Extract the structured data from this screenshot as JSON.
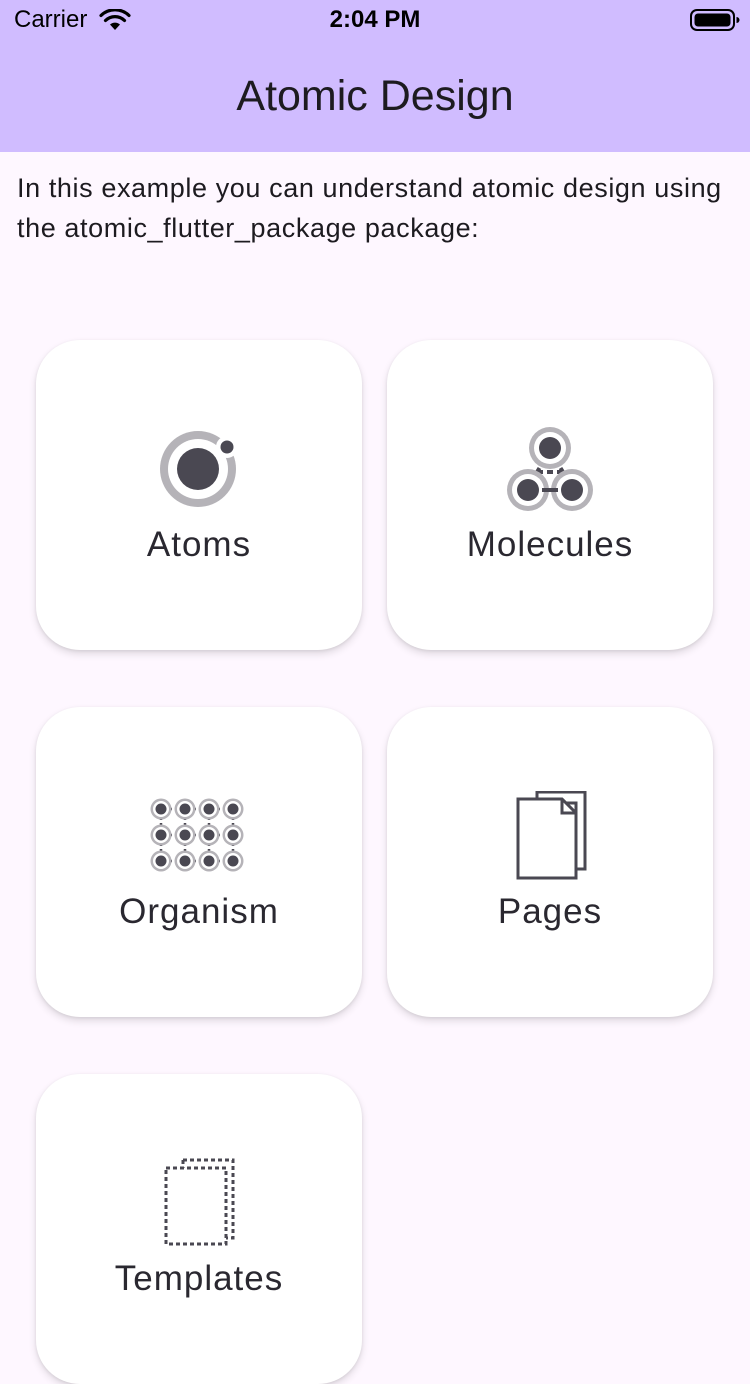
{
  "status_bar": {
    "carrier": "Carrier",
    "time": "2:04 PM",
    "wifi_icon": "wifi-icon",
    "battery_icon": "battery-icon"
  },
  "app_bar": {
    "title": "Atomic Design"
  },
  "intro_text": "In this example you can understand atomic design using the atomic_flutter_package package:",
  "cards": [
    {
      "label": "Atoms",
      "icon": "atom-icon"
    },
    {
      "label": "Molecules",
      "icon": "molecule-icon"
    },
    {
      "label": "Organism",
      "icon": "organism-icon"
    },
    {
      "label": "Pages",
      "icon": "pages-icon"
    },
    {
      "label": "Templates",
      "icon": "templates-icon"
    }
  ],
  "colors": {
    "app_bar": "#d0bcff",
    "background": "#fef7ff",
    "card": "#ffffff",
    "icon_dark": "#4a4852",
    "icon_light": "#b5b3b8"
  }
}
